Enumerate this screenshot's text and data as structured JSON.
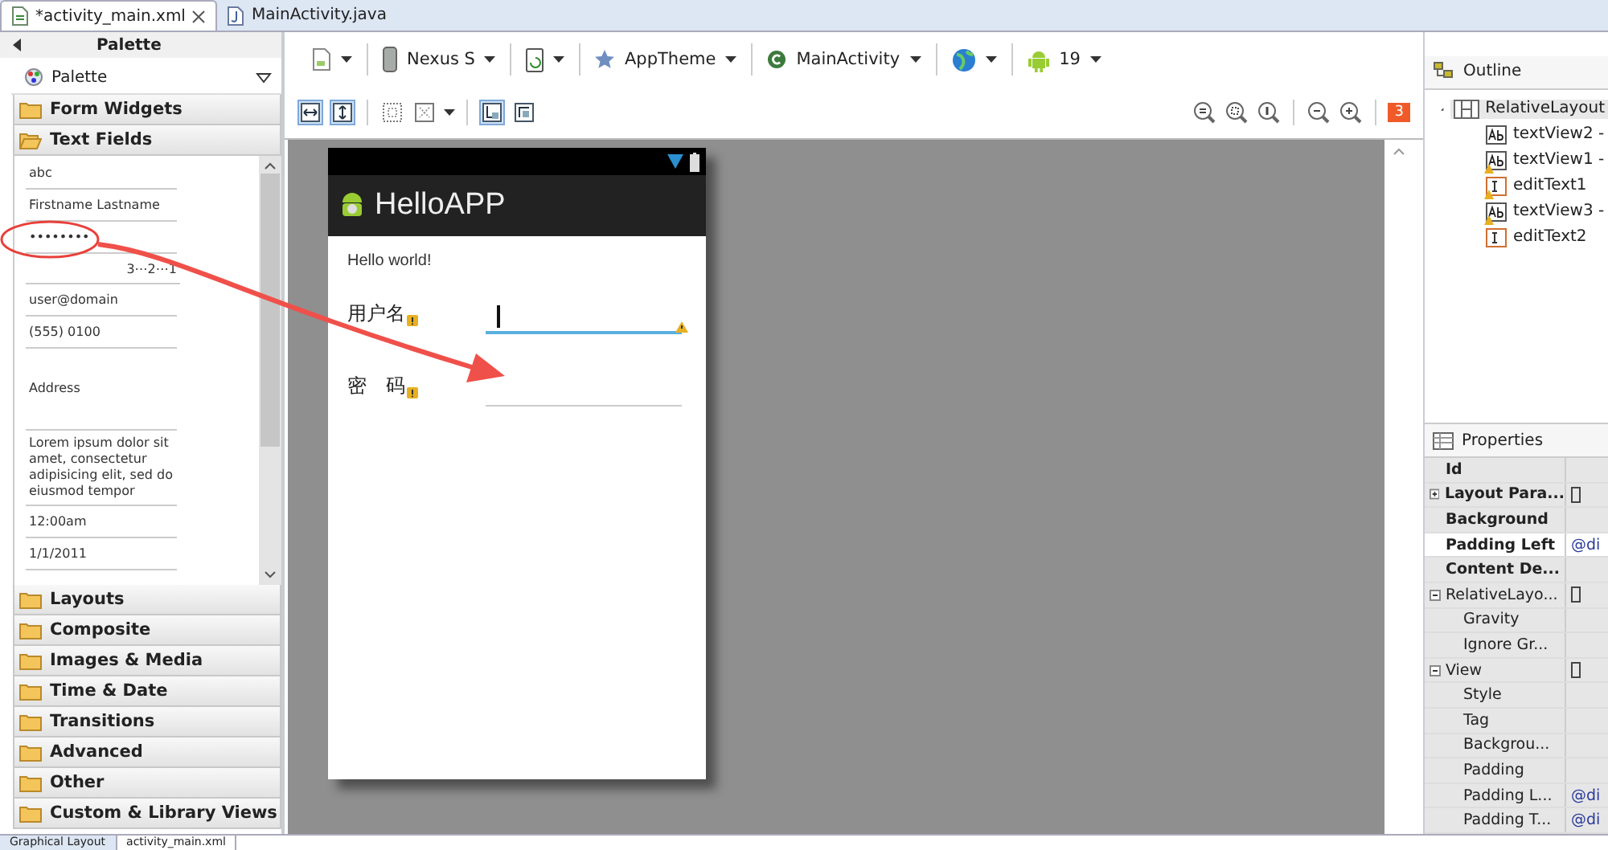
{
  "editor_tabs": [
    {
      "label": "*activity_main.xml",
      "selected": true,
      "closable": true
    },
    {
      "label": "MainActivity.java",
      "selected": false,
      "closable": false
    }
  ],
  "palette": {
    "title": "Palette",
    "dropdown": "Palette",
    "drawers_top": [
      {
        "label": "Form Widgets",
        "expanded": false
      },
      {
        "label": "Text Fields",
        "expanded": true
      }
    ],
    "text_fields": [
      {
        "text": "abc",
        "kind": "line"
      },
      {
        "text": "Firstname Lastname",
        "kind": "line"
      },
      {
        "text": "••••••••",
        "kind": "line"
      },
      {
        "text": "3⋯2⋯1",
        "kind": "right"
      },
      {
        "text": "user@domain",
        "kind": "line"
      },
      {
        "text": "(555) 0100",
        "kind": "line"
      },
      {
        "text": "Address",
        "kind": "tall"
      },
      {
        "text": "Lorem ipsum dolor sit amet, consectetur adipisicing elit, sed do eiusmod tempor",
        "kind": "multi"
      },
      {
        "text": "12:00am",
        "kind": "line"
      },
      {
        "text": "1/1/2011",
        "kind": "line"
      }
    ],
    "drawers_bottom": [
      {
        "label": "Layouts",
        "expanded": false
      },
      {
        "label": "Composite",
        "expanded": false
      },
      {
        "label": "Images & Media",
        "expanded": false
      },
      {
        "label": "Time & Date",
        "expanded": false
      },
      {
        "label": "Transitions",
        "expanded": false
      },
      {
        "label": "Advanced",
        "expanded": false
      },
      {
        "label": "Other",
        "expanded": false
      },
      {
        "label": "Custom & Library Views",
        "expanded": false
      }
    ]
  },
  "toolbar": [
    {
      "kind": "file"
    },
    {
      "kind": "device",
      "label": "Nexus S"
    },
    {
      "kind": "orientation"
    },
    {
      "kind": "theme",
      "label": "AppTheme"
    },
    {
      "kind": "activity",
      "label": "MainActivity"
    },
    {
      "kind": "locale"
    },
    {
      "kind": "api",
      "label": "19"
    }
  ],
  "toggle_groups": [
    [
      {
        "kind": "width",
        "on": true
      },
      {
        "kind": "height",
        "on": true
      }
    ],
    [
      {
        "kind": "margins",
        "on": false
      },
      {
        "kind": "clip",
        "on": false
      }
    ],
    [
      {
        "kind": "render",
        "on": true
      },
      {
        "kind": "refresh",
        "on": false
      }
    ]
  ],
  "error_count": "3",
  "phone": {
    "app_title": "HelloAPP",
    "hello": "Hello world!",
    "rows": [
      {
        "label": "用户名",
        "label_warning": true,
        "focused": true,
        "field_warning": true
      },
      {
        "label": "密　码",
        "label_warning": true,
        "focused": false,
        "field_warning": false
      }
    ]
  },
  "outline": {
    "title": "Outline",
    "root": {
      "label": "RelativeLayout",
      "expanded": true,
      "selected": true,
      "children": [
        {
          "label": "textView2 -",
          "kind": "text",
          "warning": false,
          "selected": false
        },
        {
          "label": "textView1 -",
          "kind": "text",
          "warning": true,
          "selected": false
        },
        {
          "label": "editText1",
          "kind": "edit",
          "warning": true,
          "selected": false
        },
        {
          "label": "textView3 -",
          "kind": "text",
          "warning": true,
          "selected": false
        },
        {
          "label": "editText2",
          "kind": "edit",
          "warning": false,
          "selected": false
        }
      ]
    }
  },
  "properties": {
    "title": "Properties",
    "rows": [
      {
        "name": "Id",
        "bold": true,
        "kind": "prop",
        "selected": false
      },
      {
        "name": "Layout Para...",
        "bold": true,
        "kind": "group",
        "expanded": false,
        "box": true,
        "selected": false
      },
      {
        "name": "Background",
        "bold": true,
        "kind": "prop",
        "selected": false
      },
      {
        "name": "Padding Left",
        "bold": true,
        "kind": "prop",
        "value": "@di",
        "selected": true
      },
      {
        "name": "Content De...",
        "bold": true,
        "kind": "prop",
        "selected": false
      },
      {
        "name": "RelativeLayo...",
        "bold": false,
        "kind": "group",
        "expanded": true,
        "box": true,
        "selected": false,
        "children": [
          {
            "name": "Gravity",
            "selected": false
          },
          {
            "name": "Ignore Gr...",
            "selected": false
          }
        ]
      },
      {
        "name": "View",
        "bold": false,
        "kind": "group",
        "expanded": true,
        "box": true,
        "selected": false,
        "children": [
          {
            "name": "Style",
            "selected": false
          },
          {
            "name": "Tag",
            "selected": false
          },
          {
            "name": "Backgrou...",
            "selected": false
          },
          {
            "name": "Padding",
            "selected": false
          },
          {
            "name": "Padding L...",
            "value": "@di",
            "selected": false
          },
          {
            "name": "Padding T...",
            "value": "@di",
            "selected": false
          }
        ]
      }
    ]
  },
  "bottom_tabs": [
    {
      "label": "Graphical Layout",
      "selected": true
    },
    {
      "label": "activity_main.xml",
      "selected": false
    }
  ]
}
